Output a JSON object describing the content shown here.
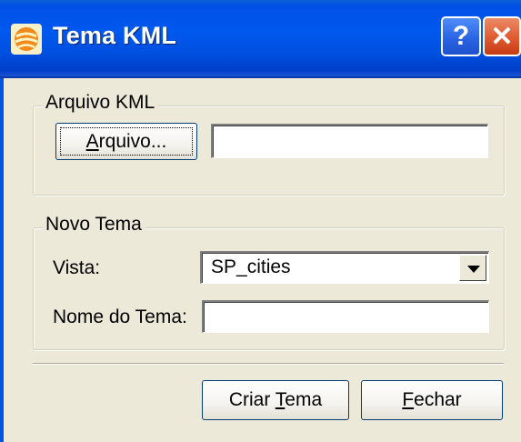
{
  "window": {
    "title": "Tema KML",
    "help_label": "?",
    "close_label": "✕",
    "colors": {
      "titlebar": "#0054e3",
      "face": "#ece9d8",
      "close": "#e05a30"
    }
  },
  "kml_group": {
    "legend": "Arquivo KML",
    "file_button_pre": "",
    "file_button_mnemonic": "A",
    "file_button_post": "rquivo...",
    "file_path_value": ""
  },
  "theme_group": {
    "legend": "Novo Tema",
    "view_label": "Vista:",
    "view_selected": "SP_cities",
    "theme_name_label": "Nome do Tema:",
    "theme_name_value": ""
  },
  "footer": {
    "create_pre": "Criar ",
    "create_mnemonic": "T",
    "create_post": "ema",
    "close_pre": "",
    "close_mnemonic": "F",
    "close_post": "echar"
  }
}
